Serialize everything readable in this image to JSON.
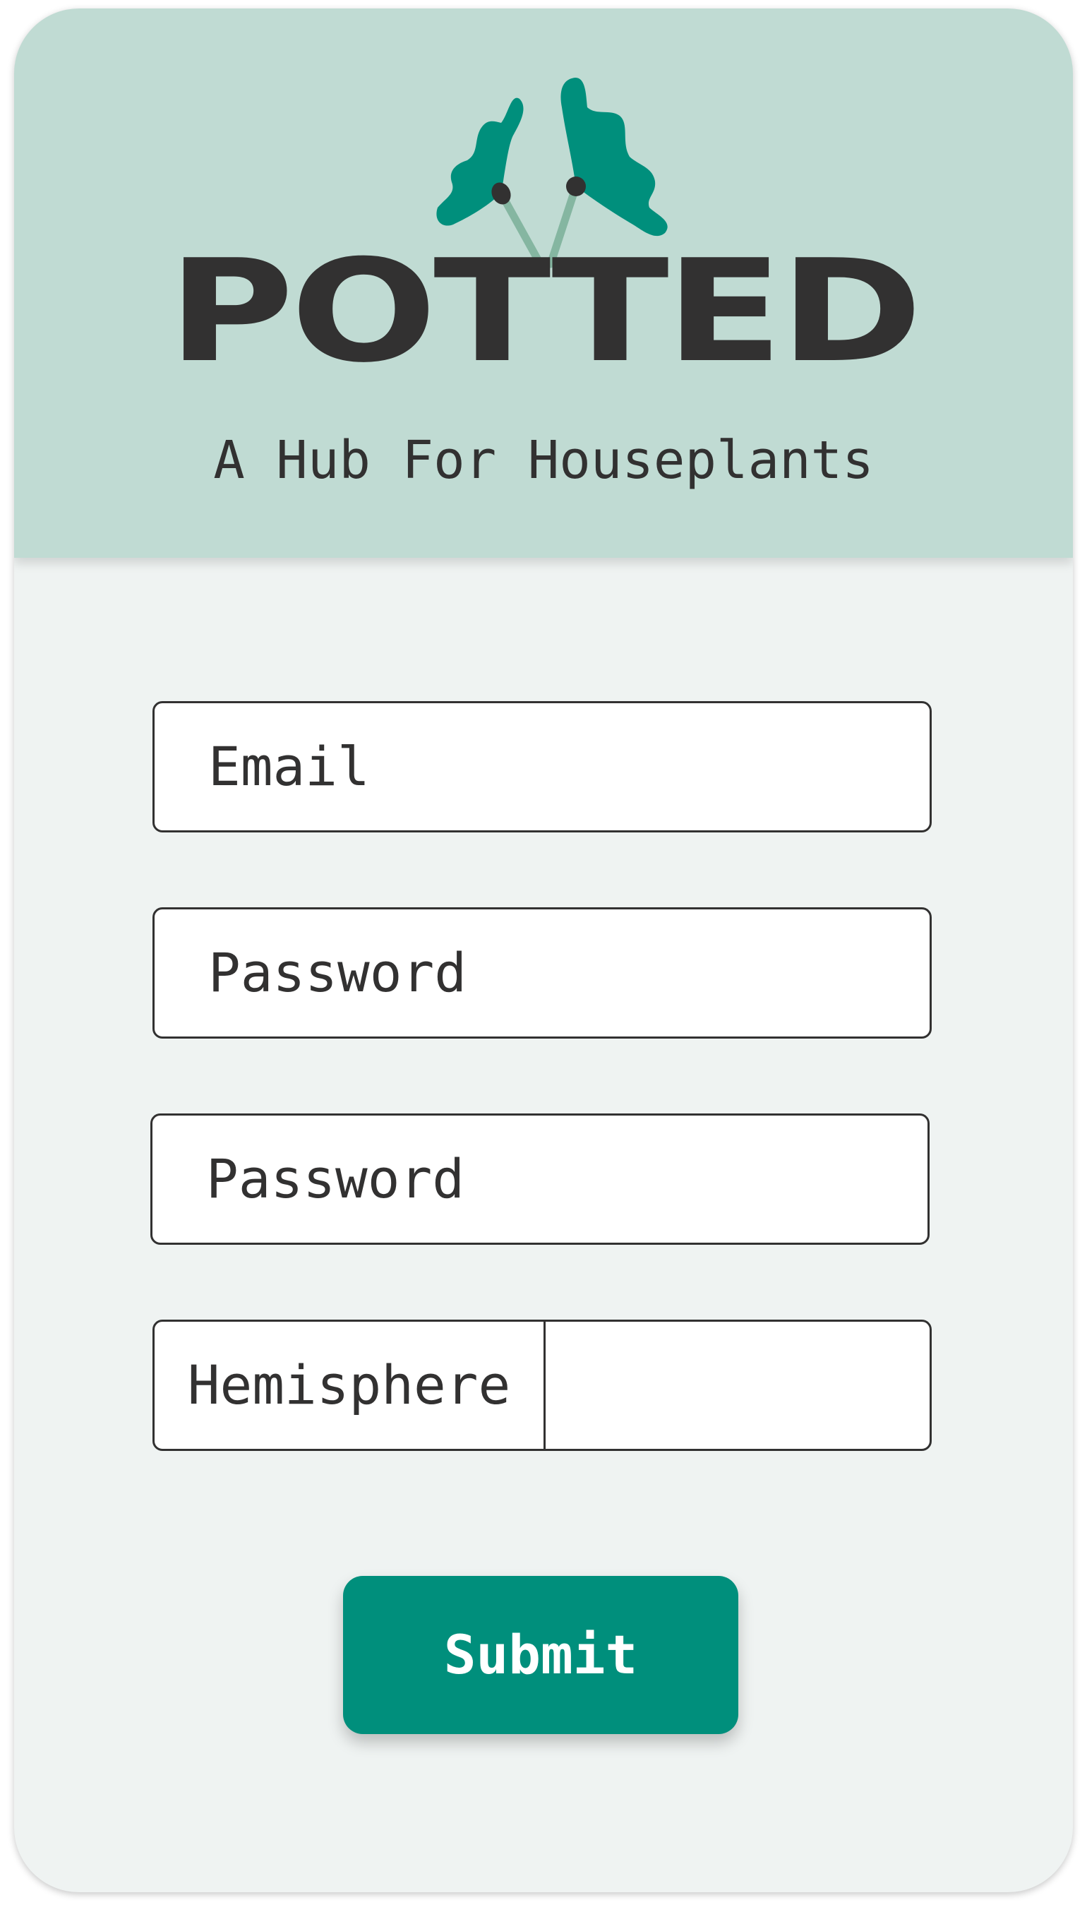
{
  "colors": {
    "header_bg": "#c0dbd3",
    "card_bg": "#eff3f2",
    "accent": "#008f7c",
    "text": "#323131",
    "stem": "#85b6a1"
  },
  "header": {
    "logo_text": "POTTED",
    "logo_icon": "plant-leaves-icon",
    "tagline": "A Hub For Houseplants"
  },
  "form": {
    "email_placeholder": "Email",
    "password_placeholder": "Password",
    "confirm_password_placeholder": "Password",
    "hemisphere_label": "Hemisphere",
    "hemisphere_value": "",
    "submit_label": "Submit"
  }
}
